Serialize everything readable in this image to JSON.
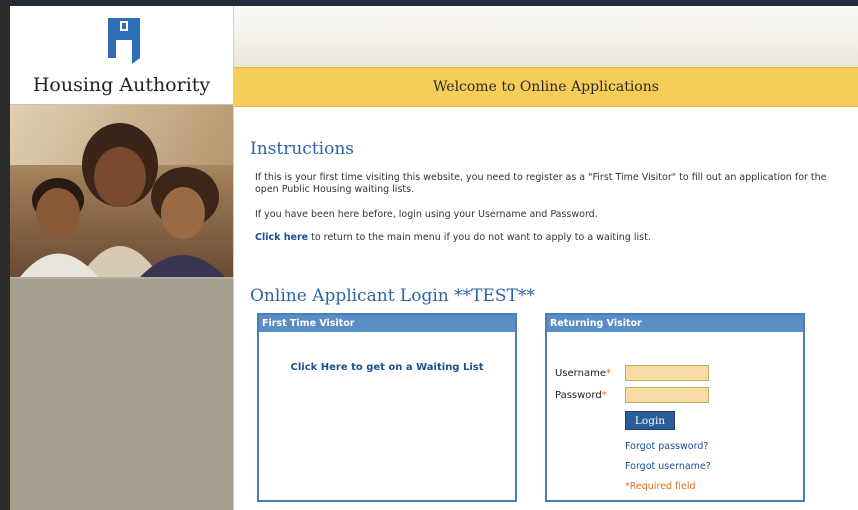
{
  "brand": {
    "name": "Housing Authority"
  },
  "header": {
    "welcome": "Welcome to Online Applications"
  },
  "instructions": {
    "title": "Instructions",
    "p1": "If this is your first time visiting this website, you need to register as a \"First Time Visitor\" to fill out an application for the open Public Housing waiting lists.",
    "p2": "If you have been here before, login using your Username and Password.",
    "p3_link": "Click here",
    "p3_text": " to return to the main menu if you do not want to apply to a waiting list."
  },
  "login": {
    "title": "Online Applicant Login **TEST**",
    "first_time": {
      "heading": "First Time Visitor",
      "link": "Click Here to get on a Waiting List"
    },
    "returning": {
      "heading": "Returning Visitor",
      "username_label": "Username",
      "password_label": "Password",
      "required_mark": "*",
      "username_value": "",
      "password_value": "",
      "login_button": "Login",
      "forgot_password": "Forgot password?",
      "forgot_username": "Forgot username?",
      "required_note": "*Required field"
    }
  },
  "colors": {
    "accent_blue": "#2e64a5",
    "panel_header": "#5a8dc6",
    "welcome_bar": "#f6cd58",
    "field_bg": "#f5dca7",
    "required": "#e36f1e",
    "sidebar": "#a59d8e"
  },
  "icons": {
    "logo": "house-h-logo-icon"
  }
}
